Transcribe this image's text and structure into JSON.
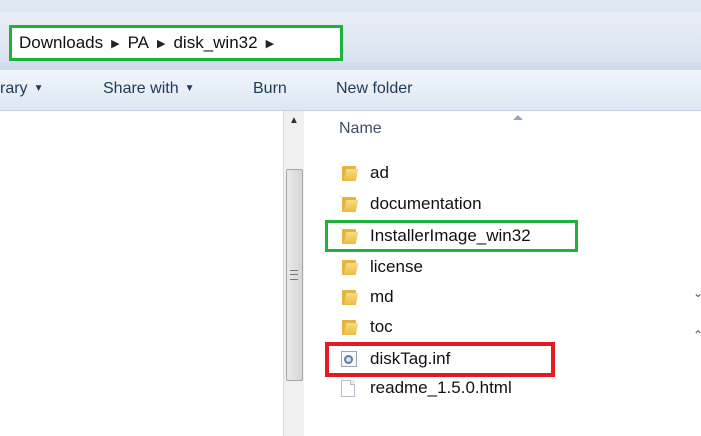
{
  "breadcrumb": {
    "items": [
      "Downloads",
      "PA",
      "disk_win32"
    ],
    "separator": "▶"
  },
  "toolbar": {
    "library_label": "rary",
    "share_label": "Share with",
    "burn_label": "Burn",
    "new_folder_label": "New folder"
  },
  "files": {
    "column_name": "Name",
    "items": [
      {
        "name": "ad",
        "type": "folder"
      },
      {
        "name": "documentation",
        "type": "folder"
      },
      {
        "name": "InstallerImage_win32",
        "type": "folder"
      },
      {
        "name": "license",
        "type": "folder"
      },
      {
        "name": "md",
        "type": "folder"
      },
      {
        "name": "toc",
        "type": "folder"
      },
      {
        "name": "diskTag.inf",
        "type": "inf-file"
      },
      {
        "name": "readme_1.5.0.html",
        "type": "html-file"
      }
    ]
  },
  "highlight_colors": {
    "green": "#1db33a",
    "red": "#e01b24"
  }
}
